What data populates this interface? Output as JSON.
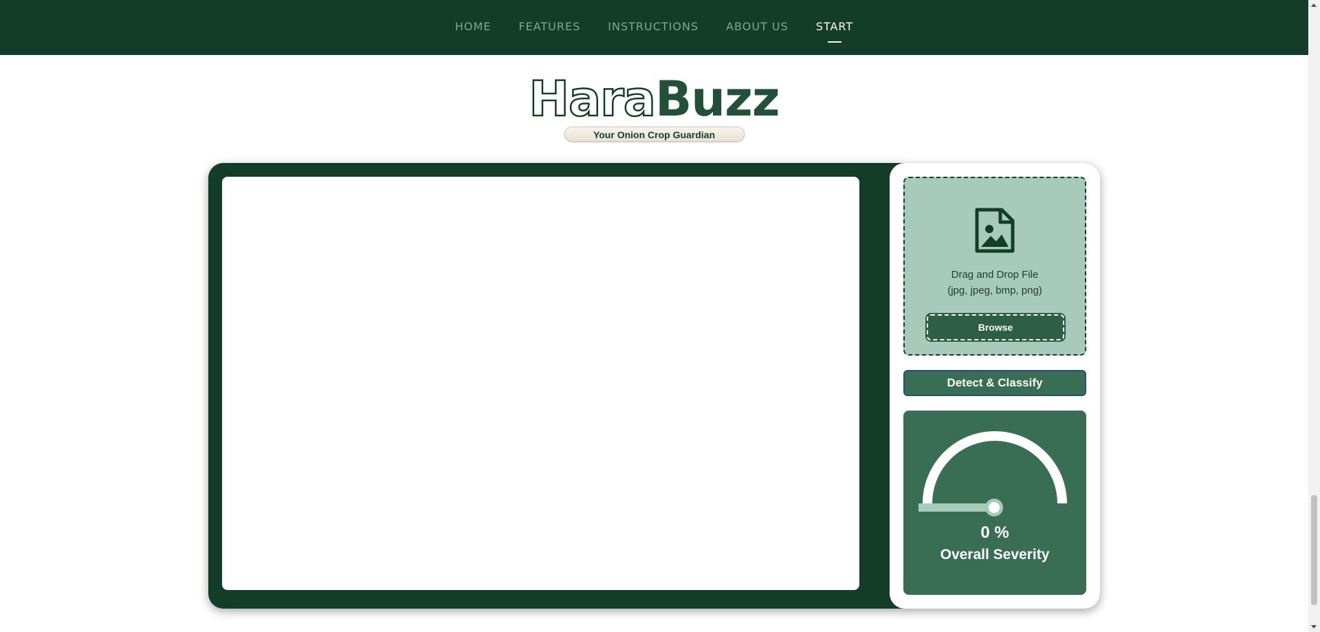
{
  "nav": {
    "items": [
      {
        "label": "HOME",
        "active": false
      },
      {
        "label": "FEATURES",
        "active": false
      },
      {
        "label": "INSTRUCTIONS",
        "active": false
      },
      {
        "label": "ABOUT US",
        "active": false
      },
      {
        "label": "START",
        "active": true
      }
    ]
  },
  "brand": {
    "logo_part1": "Hara",
    "logo_part2": "Buzz",
    "tagline": "Your Onion Crop Guardian"
  },
  "upload": {
    "icon": "image-file-icon",
    "line1": "Drag and Drop File",
    "line2": "(jpg, jpeg, bmp, png)",
    "browse_label": "Browse"
  },
  "actions": {
    "detect_label": "Detect & Classify"
  },
  "severity": {
    "value": 0,
    "value_text": "0 %",
    "label": "Overall Severity"
  },
  "colors": {
    "nav_bg": "#133d29",
    "card_bg": "#133d29",
    "dropzone_bg": "#a8cabb",
    "button_bg": "#3a6e54",
    "gauge_track": "#a8cabb"
  }
}
